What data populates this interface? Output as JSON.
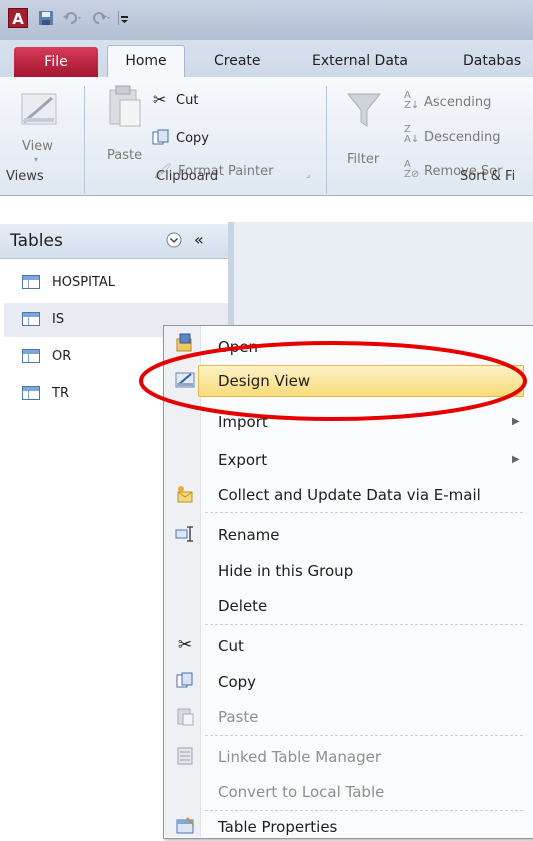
{
  "titlebar": {
    "app_icon": "A",
    "quick_access": [
      "save-icon",
      "undo-icon",
      "redo-icon",
      "customize-icon"
    ]
  },
  "tabs": {
    "file": "File",
    "home": "Home",
    "create": "Create",
    "external": "External Data",
    "database": "Databas"
  },
  "ribbon": {
    "views": {
      "view_label": "View",
      "group": "Views"
    },
    "clipboard": {
      "paste_label": "Paste",
      "cut": "Cut",
      "copy": "Copy",
      "format_painter": "Format Painter",
      "group": "Clipboard"
    },
    "sort": {
      "filter_label": "Filter",
      "ascending": "Ascending",
      "descending": "Descending",
      "remove_sort": "Remove Sor",
      "group": "Sort & Fi"
    }
  },
  "nav": {
    "title": "Tables",
    "collapse": "«",
    "items": [
      {
        "label": "HOSPITAL"
      },
      {
        "label": "IS"
      },
      {
        "label": "OR"
      },
      {
        "label": "TR"
      }
    ]
  },
  "context_menu": {
    "items": [
      {
        "label": "Open",
        "icon": "open-icon"
      },
      {
        "label": "Design View",
        "icon": "design-view-icon",
        "highlighted": true
      },
      {
        "label": "Import",
        "submenu": true
      },
      {
        "label": "Export",
        "submenu": true
      },
      {
        "label": "Collect and Update Data via E-mail",
        "icon": "collect-data-icon"
      },
      {
        "label": "Rename",
        "icon": "rename-icon"
      },
      {
        "label": "Hide in this Group"
      },
      {
        "label": "Delete"
      },
      {
        "label": "Cut",
        "icon": "cut-icon"
      },
      {
        "label": "Copy",
        "icon": "copy-icon"
      },
      {
        "label": "Paste",
        "icon": "paste-icon",
        "disabled": true
      },
      {
        "label": "Linked Table Manager",
        "icon": "linked-table-icon",
        "disabled": true
      },
      {
        "label": "Convert to Local Table",
        "disabled": true
      },
      {
        "label": "Table Properties",
        "icon": "table-properties-icon"
      }
    ]
  },
  "colors": {
    "file_tab": "#c42a46",
    "highlight": "#f9dc7b",
    "annotation": "#e60000"
  }
}
